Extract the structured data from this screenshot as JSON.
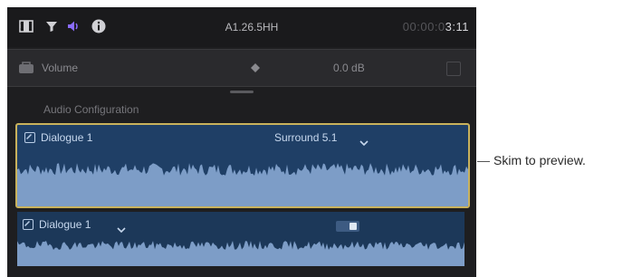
{
  "toolbar": {
    "title": "A1.26.5HH",
    "timecode_dim": "00:00:0",
    "timecode": "3:11",
    "icons": [
      "film-strip-icon",
      "filter-funnel-icon",
      "audio-speaker-icon",
      "info-icon"
    ]
  },
  "volume": {
    "label": "Volume",
    "value": "0.0 dB",
    "icons": [
      "volume-icon",
      "keyframe-icon"
    ]
  },
  "section": {
    "label": "Audio Configuration"
  },
  "lanes": [
    {
      "name": "Dialogue 1",
      "config": "Surround 5.1",
      "checked": true,
      "selected": true
    },
    {
      "name": "Dialogue 1",
      "checked": true,
      "selected": false
    }
  ],
  "callout": {
    "text": "Skim to preview."
  },
  "colors": {
    "panel_bg": "#1e1e20",
    "lane_bg": "#1f3f66",
    "waveform": "#7d9dc7",
    "selection_border": "#c9b25c",
    "accent_purple": "#8a6cff"
  }
}
